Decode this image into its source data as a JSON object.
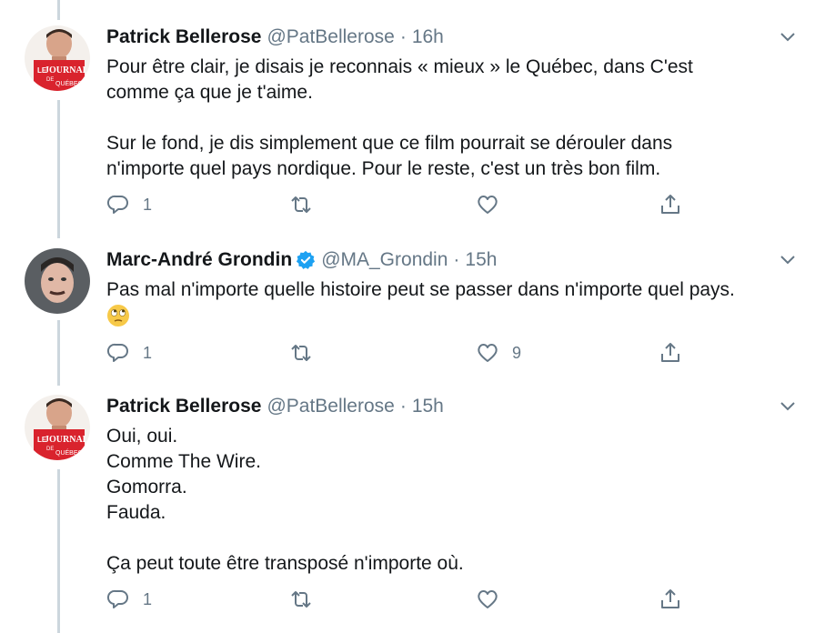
{
  "tweets": [
    {
      "name": "Patrick Bellerose",
      "handle": "@PatBellerose",
      "dot": "·",
      "time": "16h",
      "avatar_badge": [
        "LE",
        "JOURNAL",
        "DE",
        "QUÉBEC"
      ],
      "lines": [
        "Pour être clair, je disais je reconnais « mieux » le Québec, dans C'est",
        "comme ça que je t'aime.",
        "",
        "Sur le fond, je dis simplement que ce film pourrait se dérouler dans",
        "n'importe quel pays nordique. Pour le reste, c'est un très bon film."
      ],
      "reply_count": "1",
      "retweet_count": "",
      "like_count": ""
    },
    {
      "name": "Marc-André Grondin",
      "handle": "@MA_Grondin",
      "dot": "·",
      "time": "15h",
      "verified": true,
      "lines": [
        "Pas mal n'importe quelle histoire peut se passer dans n'importe quel pays."
      ],
      "emoji": "face-with-rolling-eyes",
      "reply_count": "1",
      "retweet_count": "",
      "like_count": "9"
    },
    {
      "name": "Patrick Bellerose",
      "handle": "@PatBellerose",
      "dot": "·",
      "time": "15h",
      "avatar_badge": [
        "LE",
        "JOURNAL",
        "DE",
        "QUÉBEC"
      ],
      "lines": [
        "Oui, oui.",
        "Comme The Wire.",
        "Gomorra.",
        "Fauda.",
        "",
        "Ça peut toute être transposé n'importe où."
      ],
      "reply_count": "1",
      "retweet_count": "",
      "like_count": ""
    }
  ],
  "icons": {
    "reply": "reply-icon",
    "retweet": "retweet-icon",
    "like": "heart-icon",
    "share": "share-icon",
    "more": "chevron-down-icon",
    "verified": "verified-badge-icon"
  },
  "colors": {
    "text": "#14171a",
    "secondary": "#657786",
    "verified": "#1da1f2",
    "journal_red": "#d9232d",
    "thread_line": "#ccd6dd"
  }
}
